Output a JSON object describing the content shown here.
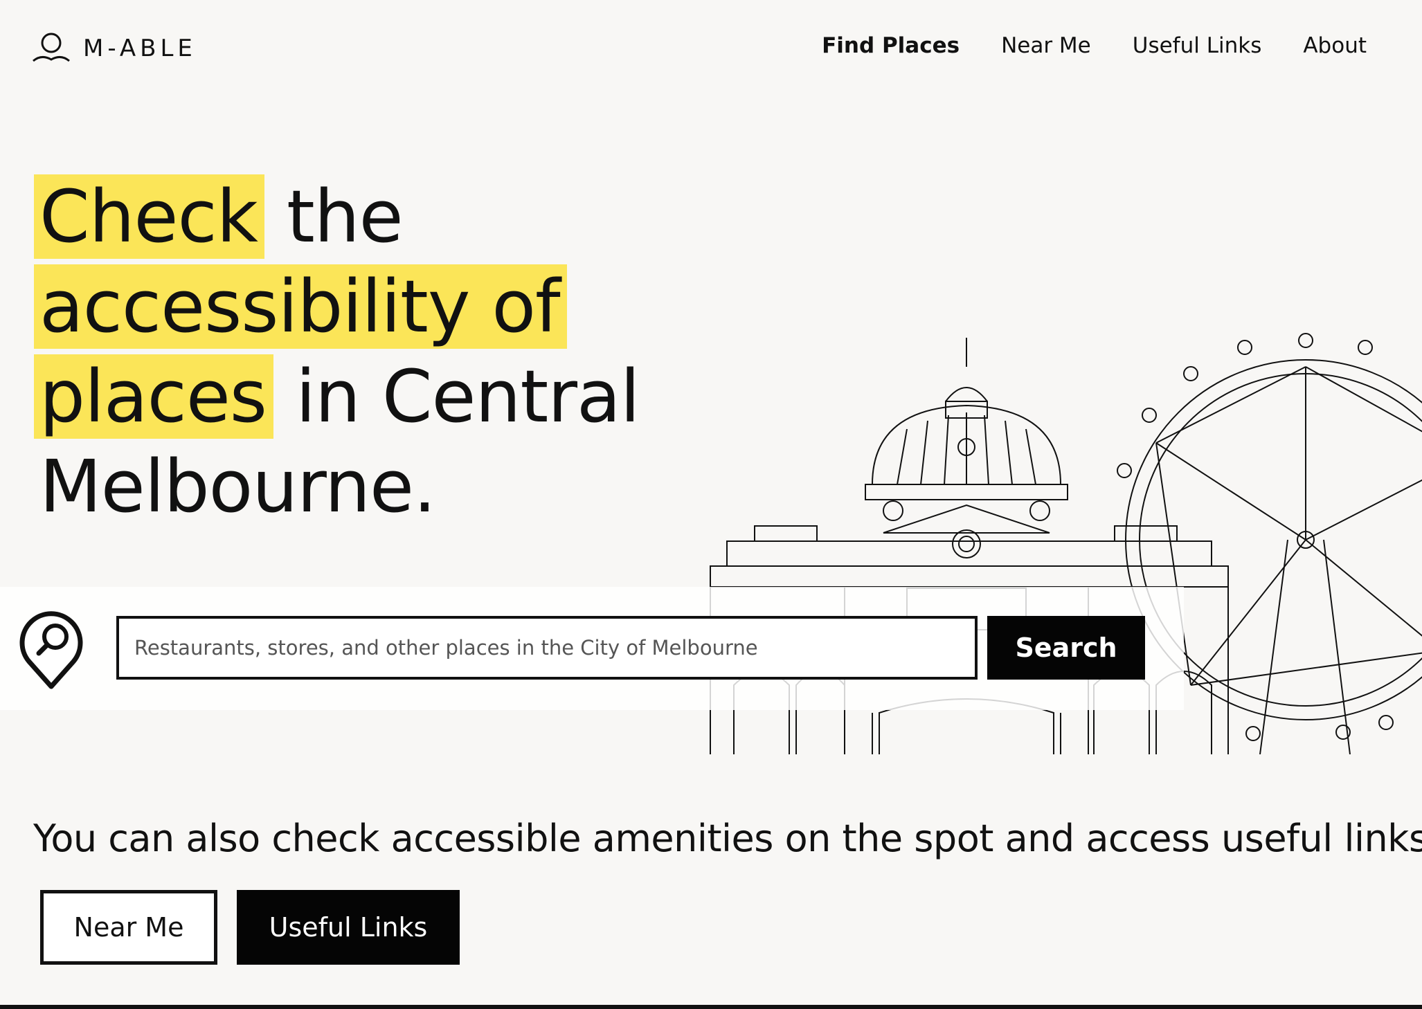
{
  "brand": {
    "name": "M-ABLE",
    "icon": "person-icon"
  },
  "nav": {
    "items": [
      {
        "label": "Find Places",
        "active": true
      },
      {
        "label": "Near Me",
        "active": false
      },
      {
        "label": "Useful Links",
        "active": false
      },
      {
        "label": "About",
        "active": false
      }
    ]
  },
  "hero": {
    "line1_highlight": "Check",
    "line1_rest": "the",
    "line2_highlight": "accessibility of",
    "line3_highlight": "places",
    "line3_rest": "in Central",
    "line4": "Melbourne.",
    "highlight_color": "#fbe558"
  },
  "search": {
    "icon": "location-search-icon",
    "placeholder": "Restaurants, stores, and other places in the City of Melbourne",
    "value": "",
    "button_label": "Search"
  },
  "secondary": {
    "text": "You can also check accessible amenities on the spot and access useful links.",
    "near_me_label": "Near Me",
    "useful_links_label": "Useful Links"
  },
  "colors": {
    "accent": "#fbe558",
    "background": "#f8f7f5",
    "dark": "#050505"
  }
}
